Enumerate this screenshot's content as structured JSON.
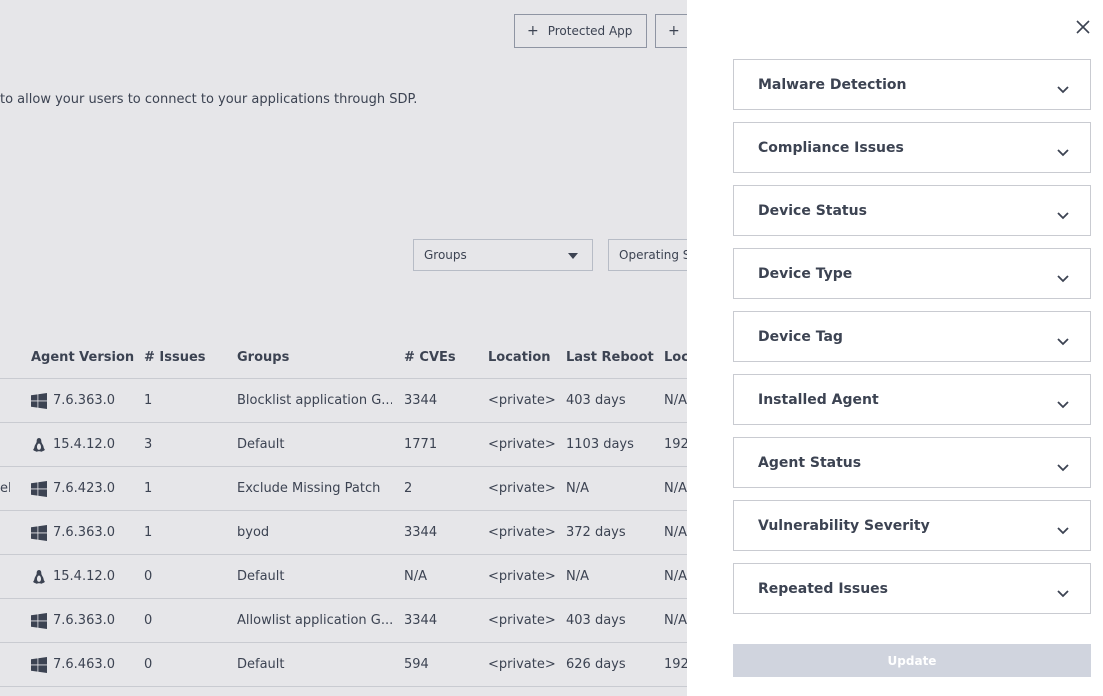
{
  "background": {
    "buttons": {
      "protected_app": "Protected App",
      "second_plus": ""
    },
    "description": "to allow your users to connect to your applications through SDP.",
    "filters": {
      "groups": "Groups",
      "operating_system": "Operating Sy"
    },
    "table": {
      "headers": {
        "agent_version": "Agent Version",
        "issues": "# Issues",
        "groups": "Groups",
        "cves": "# CVEs",
        "location": "Location",
        "last_reboot": "Last Reboot",
        "local": "Loc"
      },
      "rows": [
        {
          "edge": "",
          "os": "windows",
          "version": "7.6.363.0",
          "issues": "1",
          "group": "Blocklist application G...",
          "cves": "3344",
          "location": "<private>",
          "reboot": "403 days",
          "local": "N/A"
        },
        {
          "edge": "",
          "os": "linux",
          "version": "15.4.12.0",
          "issues": "3",
          "group": "Default",
          "cves": "1771",
          "location": "<private>",
          "reboot": "1103 days",
          "local": "192."
        },
        {
          "edge": "el",
          "os": "windows",
          "version": "7.6.423.0",
          "issues": "1",
          "group": "Exclude Missing Patch",
          "cves": "2",
          "location": "<private>",
          "reboot": "N/A",
          "local": "N/A"
        },
        {
          "edge": "",
          "os": "windows",
          "version": "7.6.363.0",
          "issues": "1",
          "group": "byod",
          "cves": "3344",
          "location": "<private>",
          "reboot": "372 days",
          "local": "N/A"
        },
        {
          "edge": "",
          "os": "linux",
          "version": "15.4.12.0",
          "issues": "0",
          "group": "Default",
          "cves": "N/A",
          "location": "<private>",
          "reboot": "N/A",
          "local": "N/A"
        },
        {
          "edge": "",
          "os": "windows",
          "version": "7.6.363.0",
          "issues": "0",
          "group": "Allowlist application G...",
          "cves": "3344",
          "location": "<private>",
          "reboot": "403 days",
          "local": "N/A"
        },
        {
          "edge": "",
          "os": "windows",
          "version": "7.6.463.0",
          "issues": "0",
          "group": "Default",
          "cves": "594",
          "location": "<private>",
          "reboot": "626 days",
          "local": "192."
        }
      ]
    }
  },
  "drawer": {
    "close_icon": "close-icon",
    "sections": [
      {
        "label": "Malware Detection"
      },
      {
        "label": "Compliance Issues"
      },
      {
        "label": "Device Status"
      },
      {
        "label": "Device Type"
      },
      {
        "label": "Device Tag"
      },
      {
        "label": "Installed Agent"
      },
      {
        "label": "Agent Status"
      },
      {
        "label": "Vulnerability Severity"
      },
      {
        "label": "Repeated Issues"
      }
    ],
    "update_label": "Update"
  }
}
